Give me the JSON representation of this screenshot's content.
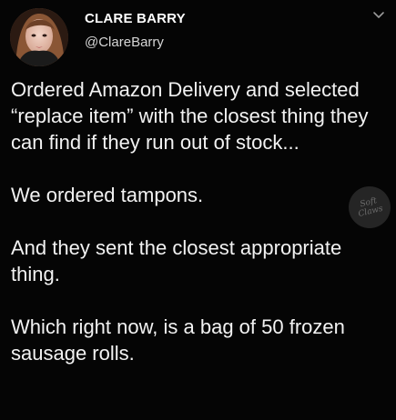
{
  "header": {
    "display_name": "CLARE BARRY",
    "handle": "@ClareBarry",
    "menu_icon": "chevron-down-icon"
  },
  "tweet": {
    "paragraphs": [
      "Ordered Amazon Delivery and selected “replace item” with the closest thing they can find if they run out of stock...",
      "We ordered tampons.",
      "And they sent the closest appropriate thing.",
      "Which right now, is a bag of 50 frozen sausage rolls."
    ]
  },
  "watermark": {
    "text": "Soft Claws"
  },
  "colors": {
    "background": "#050505",
    "text": "#f2f2f2",
    "handle": "#d6d6d6"
  }
}
